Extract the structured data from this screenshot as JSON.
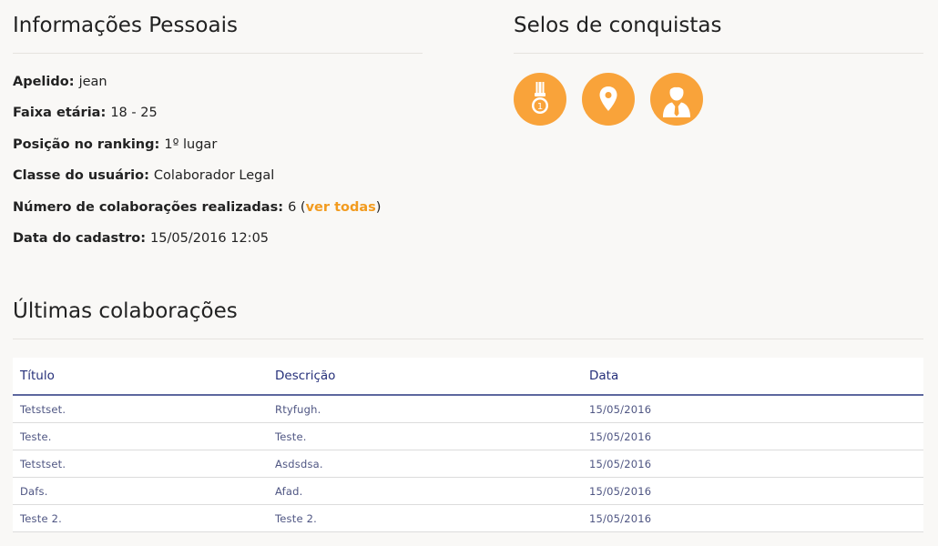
{
  "personal_info": {
    "title": "Informações Pessoais",
    "nickname_label": "Apelido:",
    "nickname_value": "jean",
    "age_range_label": "Faixa etária:",
    "age_range_value": "18 - 25",
    "ranking_label": "Posição no ranking:",
    "ranking_value": "1º lugar",
    "user_class_label": "Classe do usuário:",
    "user_class_value": "Colaborador Legal",
    "collab_count_label": "Número de colaborações realizadas:",
    "collab_count_value": "6",
    "collab_count_open": "(",
    "view_all_link": "ver todas",
    "collab_count_close": ")",
    "signup_date_label": "Data do cadastro:",
    "signup_date_value": "15/05/2016 12:05"
  },
  "achievements": {
    "title": "Selos de conquistas",
    "badges": [
      {
        "icon": "medal-icon",
        "color": "#f9a33a"
      },
      {
        "icon": "map-pin-icon",
        "color": "#f9a33a"
      },
      {
        "icon": "businessman-icon",
        "color": "#f9a33a"
      }
    ]
  },
  "recent": {
    "title": "Últimas colaborações",
    "columns": [
      "Título",
      "Descrição",
      "Data"
    ],
    "rows": [
      [
        "Tetstset.",
        "Rtyfugh.",
        "15/05/2016"
      ],
      [
        "Teste.",
        "Teste.",
        "15/05/2016"
      ],
      [
        "Tetstset.",
        "Asdsdsa.",
        "15/05/2016"
      ],
      [
        "Dafs.",
        "Afad.",
        "15/05/2016"
      ],
      [
        "Teste 2.",
        "Teste 2.",
        "15/05/2016"
      ]
    ]
  },
  "colors": {
    "accent_orange": "#f29b1f",
    "badge_orange": "#f9a33a",
    "table_header": "#26307a",
    "table_text": "#4f5683"
  }
}
